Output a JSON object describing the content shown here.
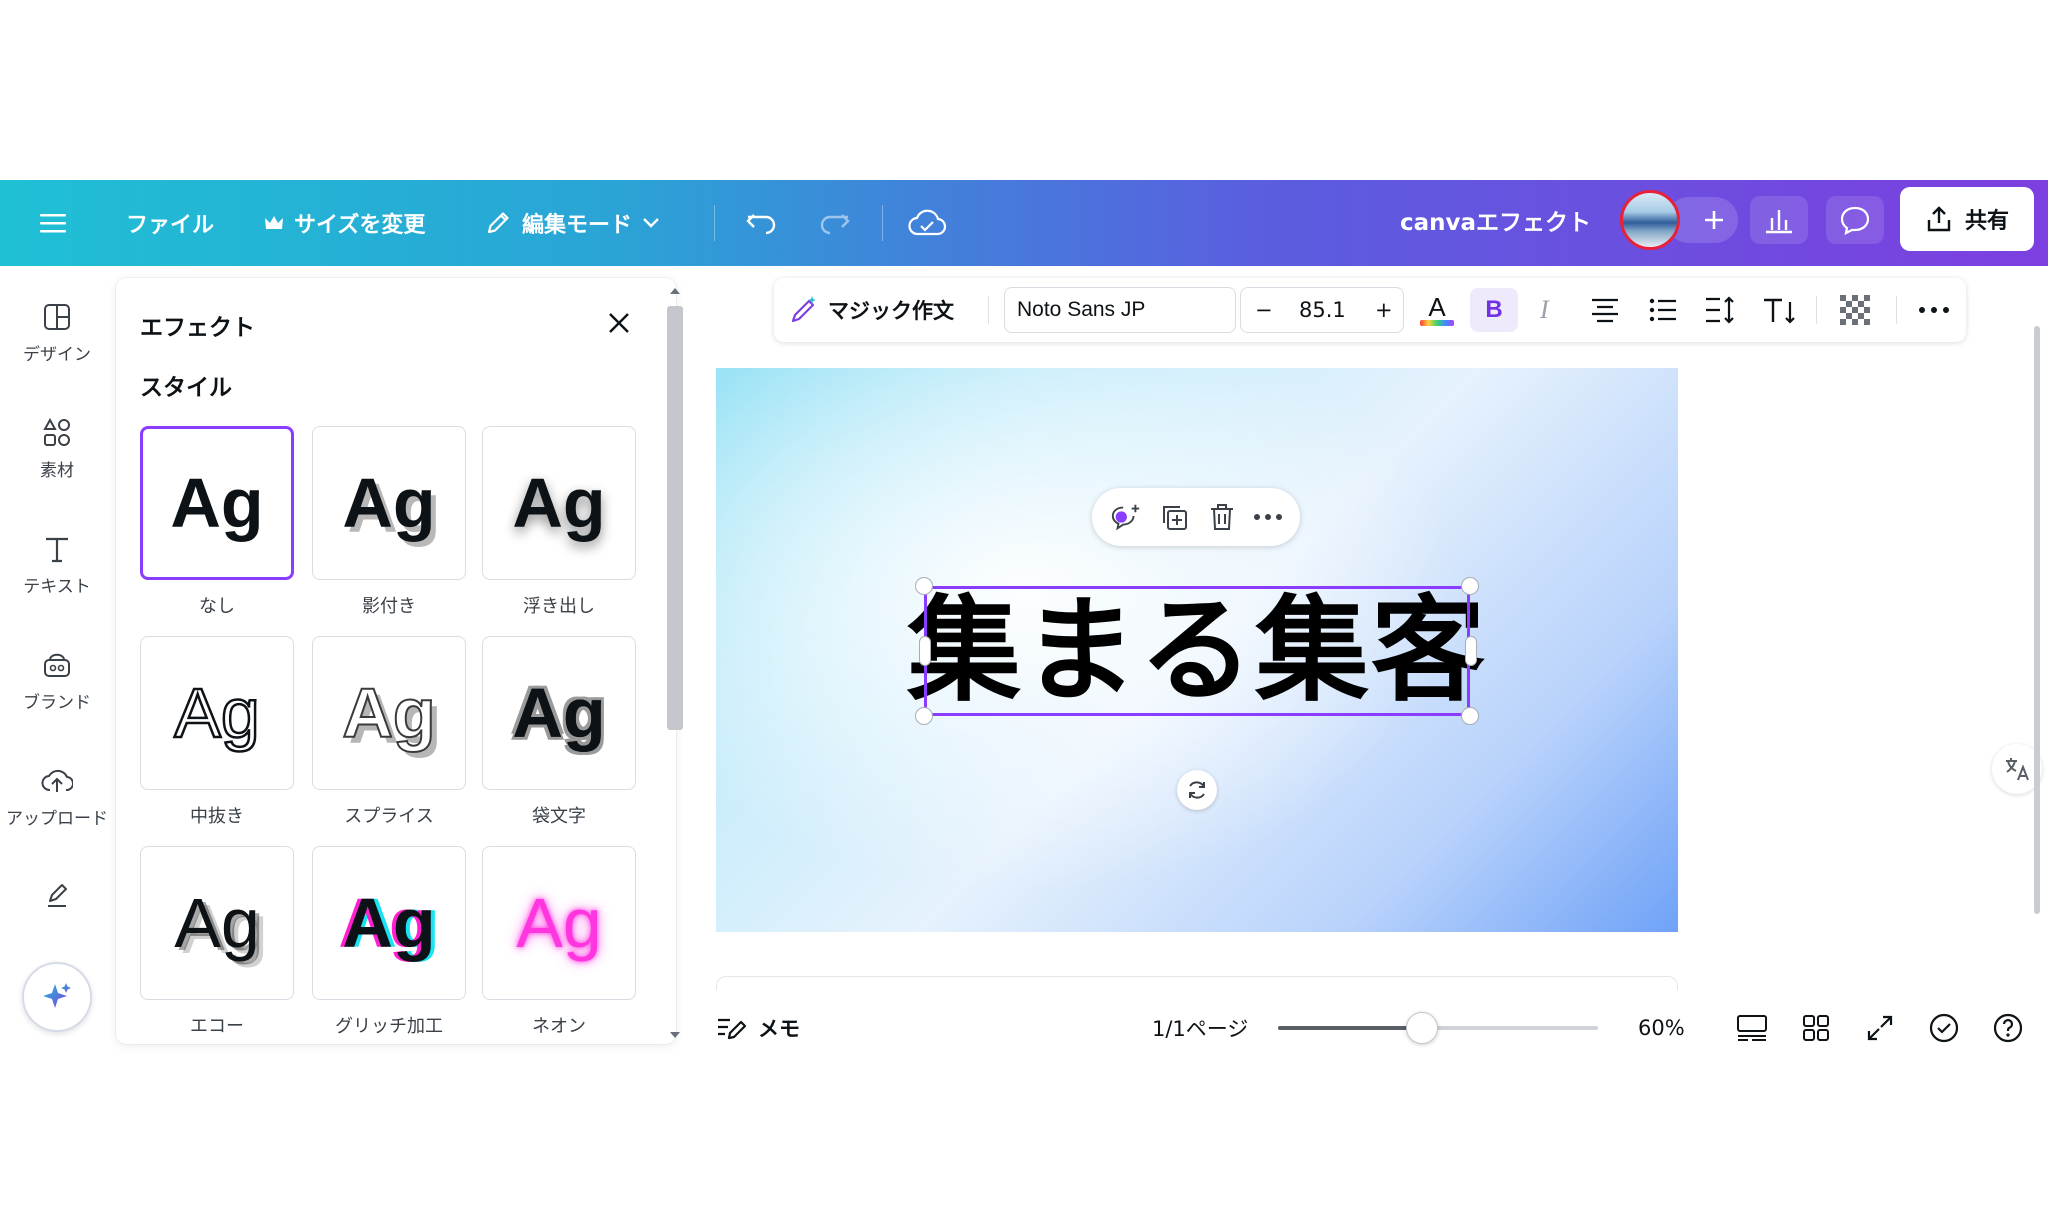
{
  "header": {
    "menu_icon": "hamburger-icon",
    "file_label": "ファイル",
    "resize_label": "サイズを変更",
    "edit_mode_label": "編集モード",
    "doc_title": "canvaエフェクト",
    "share_label": "共有",
    "gradient_start": "#1fc0d4",
    "gradient_end": "#7d3fe0"
  },
  "sidebar": {
    "items": [
      {
        "label": "デザイン",
        "icon": "design-icon"
      },
      {
        "label": "素材",
        "icon": "elements-icon"
      },
      {
        "label": "テキスト",
        "icon": "text-icon"
      },
      {
        "label": "ブランド",
        "icon": "brand-icon"
      },
      {
        "label": "アップロード",
        "icon": "upload-icon"
      },
      {
        "label": "",
        "icon": "draw-icon"
      }
    ],
    "magic_icon": "sparkle-icon"
  },
  "effects_panel": {
    "title": "エフェクト",
    "section": "スタイル",
    "styles": [
      {
        "label": "なし",
        "selected": true
      },
      {
        "label": "影付き"
      },
      {
        "label": "浮き出し"
      },
      {
        "label": "中抜き"
      },
      {
        "label": "スプライス"
      },
      {
        "label": "袋文字"
      },
      {
        "label": "エコー"
      },
      {
        "label": "グリッチ加工"
      },
      {
        "label": "ネオン"
      }
    ],
    "preview_text": "Ag",
    "accent": "#8b3dff"
  },
  "text_toolbar": {
    "magic_write_label": "マジック作文",
    "font_name": "Noto Sans JP",
    "font_size": "85.1",
    "minus": "−",
    "plus": "+",
    "bold": "B",
    "italic": "I",
    "text_color_letter": "A"
  },
  "canvas": {
    "headline": "集まる集客"
  },
  "footer": {
    "notes_label": "メモ",
    "page_indicator": "1/1ページ",
    "zoom": "60%",
    "zoom_fraction": 0.45
  }
}
